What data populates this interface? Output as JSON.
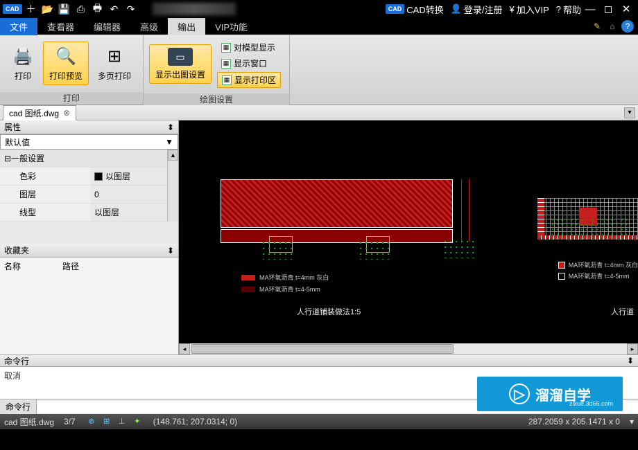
{
  "titlebar": {
    "cad_convert": "CAD转换",
    "login": "登录/注册",
    "vip": "加入VIP",
    "help": "帮助"
  },
  "menu": {
    "file": "文件",
    "viewer": "查看器",
    "editor": "编辑器",
    "advanced": "高级",
    "output": "输出",
    "vip_func": "VIP功能"
  },
  "ribbon": {
    "print_group": "打印",
    "print": "打印",
    "print_preview": "打印预览",
    "multi_print": "多页打印",
    "plot_group": "绘图设置",
    "plot_settings": "显示出图设置",
    "show_model": "对模型显示",
    "show_window": "显示窗口",
    "show_print_area": "显示打印区"
  },
  "doc": {
    "name": "cad 图纸.dwg"
  },
  "props": {
    "title": "属性",
    "default": "默认值",
    "general": "一般设置",
    "rows": [
      {
        "k": "色彩",
        "v": "以图层"
      },
      {
        "k": "图层",
        "v": "0"
      },
      {
        "k": "线型",
        "v": "以图层"
      }
    ]
  },
  "fav": {
    "title": "收藏夹",
    "col1": "名称",
    "col2": "路径"
  },
  "cmd": {
    "title": "命令行",
    "last": "取消",
    "label": "命令行"
  },
  "canvas": {
    "caption": "人行道铺装做法1:5",
    "legend1": "MA环氧沥青 t=4mm 灰白",
    "legend2": "MA环氧沥青 t=4-5mm",
    "side_caption": "人行道"
  },
  "status": {
    "file": "cad 图纸.dwg",
    "page": "3/7",
    "coords": "(148.761; 207.0314; 0)",
    "dims": "287.2059 x 205.1471 x 0"
  },
  "watermark": {
    "text": "溜溜自学",
    "sub": "zixue.3d66.com"
  }
}
